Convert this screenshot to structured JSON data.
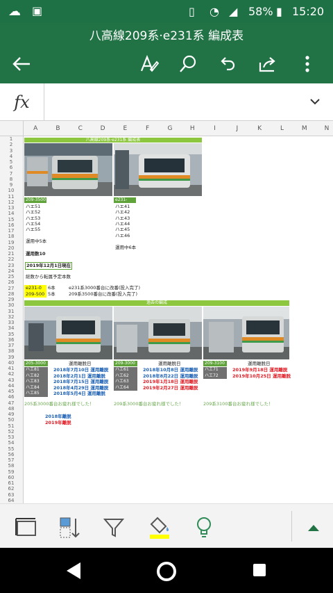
{
  "status": {
    "battery_percent": "58%",
    "time": "15:20"
  },
  "app": {
    "title": "八高線209系·e231系 編成表"
  },
  "formula_bar": {
    "fx_label": "fx",
    "value": ""
  },
  "columns": [
    "A",
    "B",
    "C",
    "D",
    "E",
    "F",
    "G",
    "H",
    "I",
    "J",
    "K",
    "L",
    "M",
    "N"
  ],
  "rows": [
    "1",
    "2",
    "3",
    "4",
    "5",
    "6",
    "7",
    "8",
    "9",
    "10",
    "11",
    "12",
    "13",
    "14",
    "15",
    "16",
    "17",
    "18",
    "19",
    "20",
    "21",
    "22",
    "23",
    "24",
    "25",
    "26",
    "27",
    "28",
    "29",
    "30",
    "31",
    "32",
    "33",
    "34",
    "35",
    "36",
    "37",
    "38",
    "39",
    "40",
    "41",
    "42",
    "43",
    "44",
    "45",
    "46",
    "47",
    "48",
    "49",
    "50",
    "51",
    "52",
    "53",
    "54",
    "55",
    "56",
    "57",
    "58",
    "59",
    "60",
    "61",
    "62",
    "63",
    "64"
  ],
  "sheet": {
    "header1": "八高線209系·e231系 編成表",
    "left_tag": "209-3500",
    "left_units": [
      "ハエ51",
      "ハエ52",
      "ハエ53",
      "ハエ54",
      "ハエ55"
    ],
    "left_count": "運用中5本",
    "right_tag": "e231-3000",
    "right_units": [
      "ハエ41",
      "ハエ42",
      "ハエ43",
      "ハエ44",
      "ハエ45",
      "ハエ46"
    ],
    "right_count": "運用中6本",
    "total": "運用数10",
    "date": "2019年12月1日現在",
    "plan": "総数から転属予定本数",
    "e231_label": "e231-0",
    "e231_count": "6本",
    "e231_note": "e231系3000番台に改番(投入完了)",
    "s209_label": "209-500",
    "s209_count": "5本",
    "s209_note": "209系3500番台に改番(投入完了)",
    "header2": "過去の編成",
    "groups": [
      {
        "tag": "205-3000",
        "date_header": "運用離脱日",
        "units": [
          "ハエ81",
          "ハエ82",
          "ハエ83",
          "ハエ84",
          "ハエ85"
        ],
        "dates": [
          {
            "t": "2018年7月10日 運用離脱",
            "c": "blue"
          },
          {
            "t": "2018年2月1日 運用離脱",
            "c": "blue"
          },
          {
            "t": "2018年7月15日 運用離脱",
            "c": "blue"
          },
          {
            "t": "2018年4月29日 運用離脱",
            "c": "blue"
          },
          {
            "t": "2018年5月4日 運用離脱",
            "c": "blue"
          }
        ],
        "thanks": "205系3000番台お疲れ様でした！"
      },
      {
        "tag": "209-3000",
        "date_header": "運用離脱日",
        "units": [
          "ハエ61",
          "ハエ62",
          "ハエ63",
          "ハエ64"
        ],
        "dates": [
          {
            "t": "2018年10月8日 運用離脱",
            "c": "blue"
          },
          {
            "t": "2018年8月22日 運用離脱",
            "c": "blue"
          },
          {
            "t": "2019年1月18日 運用離脱",
            "c": "red"
          },
          {
            "t": "2019年2月27日 運用離脱",
            "c": "red"
          }
        ],
        "thanks": "209系3000番台お疲れ様でした！"
      },
      {
        "tag": "209-3100",
        "date_header": "運用離脱日",
        "units": [
          "ハエ71",
          "ハエ72"
        ],
        "dates": [
          {
            "t": "2019年9月18日 運用離脱",
            "c": "red"
          },
          {
            "t": "2019年10月25日 運用離脱",
            "c": "red"
          }
        ],
        "thanks": "209系3100番台お疲れ様でした！"
      }
    ],
    "legend_2018": "2018年離脱",
    "legend_2019": "2019年離脱"
  },
  "colors": {
    "excel_green": "#217346",
    "status_green": "#1e7145",
    "sheet_green": "#8dc63f",
    "tag_green": "#5fa33a",
    "highlight_yellow": "#ffff00",
    "blue": "#1a5fb4",
    "red": "#e01b24"
  }
}
